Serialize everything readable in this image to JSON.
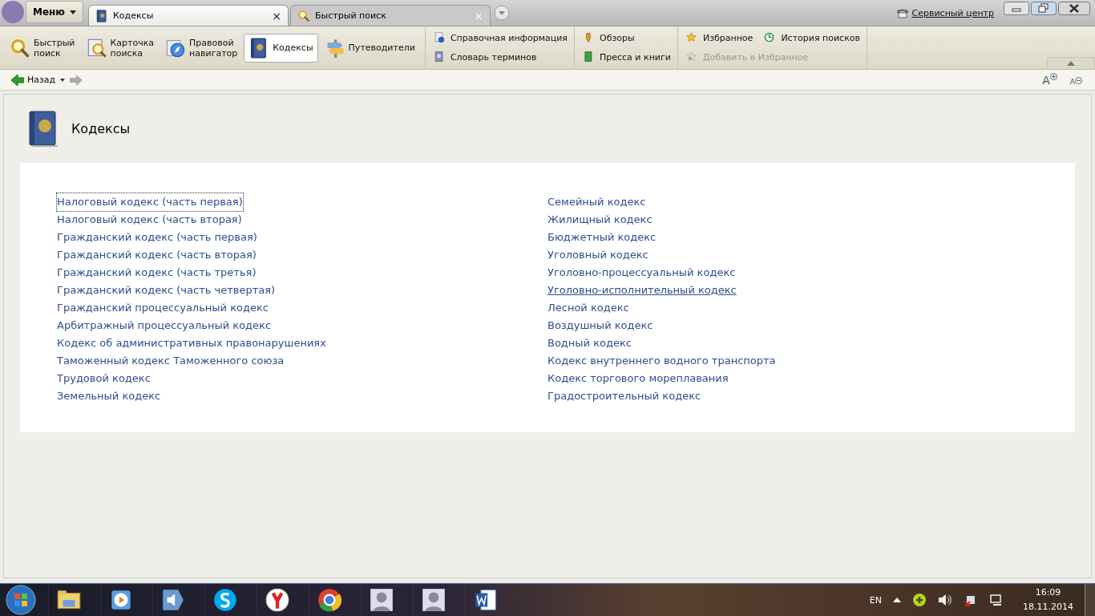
{
  "menu_button": {
    "label": "Меню"
  },
  "tabs": [
    {
      "label": "Кодексы",
      "selected": true,
      "close": "×"
    },
    {
      "label": "Быстрый поиск",
      "selected": false,
      "close": "×"
    }
  ],
  "service_link": {
    "label": "Сервисный центр"
  },
  "toolbar": {
    "big_buttons": [
      {
        "label": "Быстрый\nпоиск",
        "selected": false
      },
      {
        "label": "Карточка\nпоиска",
        "selected": false
      },
      {
        "label": "Правовой\nнавигатор",
        "selected": false
      },
      {
        "label": "Кодексы",
        "selected": true
      },
      {
        "label": "Путеводители",
        "selected": false
      }
    ],
    "groups": [
      [
        [
          {
            "label": "Справочная информация",
            "disabled": false
          }
        ],
        [
          {
            "label": "Словарь терминов",
            "disabled": false
          }
        ]
      ],
      [
        [
          {
            "label": "Обзоры",
            "disabled": false
          }
        ],
        [
          {
            "label": "Пресса и книги",
            "disabled": false
          }
        ]
      ],
      [
        [
          {
            "label": "Избранное",
            "disabled": false
          },
          {
            "label": "История поисков",
            "disabled": false
          }
        ],
        [
          {
            "label": "Добавить в Избранное",
            "disabled": true
          }
        ]
      ]
    ]
  },
  "nav": {
    "back": "Назад",
    "font_increase": "A",
    "font_decrease": "A"
  },
  "page": {
    "title": "Кодексы",
    "columns": [
      [
        {
          "label": "Налоговый кодекс (часть первая)",
          "focused": true,
          "hovered": false
        },
        {
          "label": "Налоговый кодекс (часть вторая)",
          "focused": false,
          "hovered": false
        },
        {
          "label": "Гражданский кодекс (часть первая)",
          "focused": false,
          "hovered": false
        },
        {
          "label": "Гражданский кодекс (часть вторая)",
          "focused": false,
          "hovered": false
        },
        {
          "label": "Гражданский кодекс (часть третья)",
          "focused": false,
          "hovered": false
        },
        {
          "label": "Гражданский кодекс (часть четвертая)",
          "focused": false,
          "hovered": false
        },
        {
          "label": "Гражданский процессуальный кодекс",
          "focused": false,
          "hovered": false
        },
        {
          "label": "Арбитражный процессуальный кодекс",
          "focused": false,
          "hovered": false
        },
        {
          "label": "Кодекс об административных правонарушениях",
          "focused": false,
          "hovered": false
        },
        {
          "label": "Таможенный кодекс Таможенного союза",
          "focused": false,
          "hovered": false
        },
        {
          "label": "Трудовой кодекс",
          "focused": false,
          "hovered": false
        },
        {
          "label": "Земельный кодекс",
          "focused": false,
          "hovered": false
        }
      ],
      [
        {
          "label": "Семейный кодекс",
          "focused": false,
          "hovered": false
        },
        {
          "label": "Жилищный кодекс",
          "focused": false,
          "hovered": false
        },
        {
          "label": "Бюджетный кодекс",
          "focused": false,
          "hovered": false
        },
        {
          "label": "Уголовный кодекс",
          "focused": false,
          "hovered": false
        },
        {
          "label": "Уголовно-процессуальный кодекс",
          "focused": false,
          "hovered": false
        },
        {
          "label": "Уголовно-исполнительный кодекс",
          "focused": false,
          "hovered": true
        },
        {
          "label": "Лесной кодекс",
          "focused": false,
          "hovered": false
        },
        {
          "label": "Воздушный кодекс",
          "focused": false,
          "hovered": false
        },
        {
          "label": "Водный кодекс",
          "focused": false,
          "hovered": false
        },
        {
          "label": "Кодекс внутреннего водного транспорта",
          "focused": false,
          "hovered": false
        },
        {
          "label": "Кодекс торгового мореплавания",
          "focused": false,
          "hovered": false
        },
        {
          "label": "Градостроительный кодекс",
          "focused": false,
          "hovered": false
        }
      ]
    ]
  },
  "taskbar": {
    "apps": [
      {
        "kind": "folder"
      },
      {
        "kind": "player"
      },
      {
        "kind": "speaker"
      },
      {
        "kind": "messenger"
      },
      {
        "kind": "yandex"
      },
      {
        "kind": "chrome"
      },
      {
        "kind": "avatar"
      },
      {
        "kind": "avatar"
      },
      {
        "kind": "word"
      }
    ],
    "language": "EN",
    "time": "16:09",
    "date": "18.11.2014"
  }
}
